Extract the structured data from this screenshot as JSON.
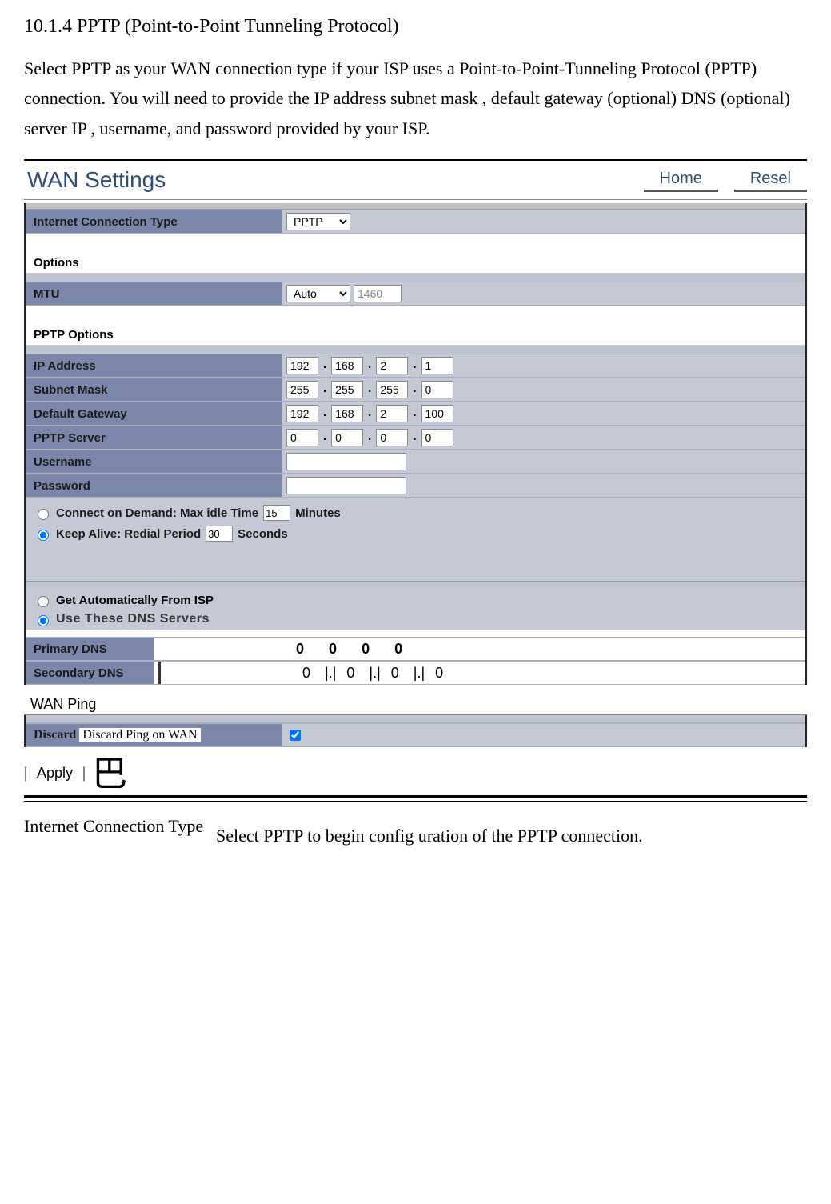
{
  "section_number": "10.1.4",
  "section_title": "PPTP (Point-to-Point Tunneling Protocol)",
  "intro_text": "Select PPTP as your WAN connection type if your ISP uses a Point-to-Point-Tunneling Protocol (PPTP) connection. You will need to provide the IP address  subnet  mask , default gateway (optional)  DNS (optional)  server IP , username, and  password  provided  by your ISP.",
  "page_title": "WAN Settings",
  "topnav": {
    "home": "Home",
    "reset": "Resel"
  },
  "labels": {
    "connection_type": "Internet Connection Type",
    "options": "Options",
    "mtu": "MTU",
    "pptp_options": "PPTP Options",
    "ip_address": "IP Address",
    "subnet_mask": "Subnet Mask",
    "default_gateway": "Default Gateway",
    "pptp_server": "PPTP Server",
    "username": "Username",
    "password": "Password",
    "connect_on_demand": "Connect on Demand: Max idle Time",
    "minutes": "Minutes",
    "keep_alive": "Keep Alive: Redial Period",
    "seconds": "Seconds",
    "get_from_isp": "Get Automatically From ISP",
    "use_these_dns": "Use These DNS Servers",
    "primary_dns": "Primary DNS",
    "secondary_dns": "Secondary DNS",
    "wan_ping": "WAN Ping",
    "discard_ping": "Discard Ping on WAN",
    "apply": "Apply"
  },
  "values": {
    "connection_type": "PPTP",
    "mtu_mode": "Auto",
    "mtu_value": "1460",
    "ip": [
      "192",
      "168",
      "2",
      "1"
    ],
    "mask": [
      "255",
      "255",
      "255",
      "0"
    ],
    "gateway": [
      "192",
      "168",
      "2",
      "100"
    ],
    "server": [
      "0",
      "0",
      "0",
      "0"
    ],
    "username": "",
    "password": "",
    "idle_time": "15",
    "redial": "30",
    "primary_dns": [
      "0",
      "0",
      "0",
      "0"
    ],
    "secondary_dns": [
      "0",
      "0",
      "0",
      "0"
    ],
    "discard_ping_checked": true
  },
  "definition": {
    "term": "Internet Connection Type",
    "desc": "Select  PPTP to  begin  config uration  of the  PPTP connection."
  }
}
